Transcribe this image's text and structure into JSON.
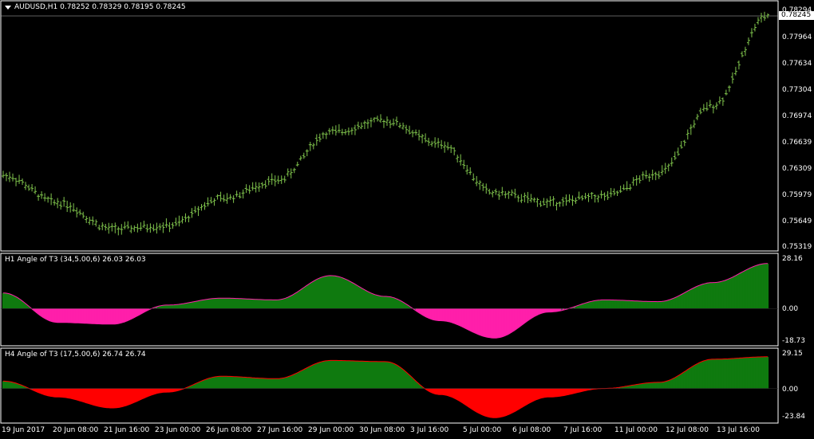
{
  "main_pane": {
    "title": "AUDUSD,H1  0.78252 0.78329 0.78195 0.78245",
    "price_scale": [
      "0.78294",
      "0.77964",
      "0.77634",
      "0.77304",
      "0.76974",
      "0.76639",
      "0.76309",
      "0.75979",
      "0.75649",
      "0.75319"
    ],
    "current_price": "0.78245",
    "icon": "chevron-down-icon"
  },
  "indicator_1": {
    "title": "H1 Angle of T3 (34,5.00,6) 26.03 26.03",
    "scale": [
      "28.16",
      "0.00",
      "-18.73"
    ]
  },
  "indicator_2": {
    "title": "H4 Angle of T3 (17,5.00,6) 26.74 26.74",
    "scale": [
      "29.15",
      "0.00",
      "-23.84"
    ]
  },
  "time_axis": [
    "19 Jun 2017",
    "20 Jun 08:00",
    "21 Jun 16:00",
    "23 Jun 00:00",
    "26 Jun 08:00",
    "27 Jun 16:00",
    "29 Jun 00:00",
    "30 Jun 08:00",
    "3 Jul 16:00",
    "5 Jul 00:00",
    "6 Jul 08:00",
    "7 Jul 16:00",
    "11 Jul 00:00",
    "12 Jul 08:00",
    "13 Jul 16:00"
  ],
  "colors": {
    "background": "#000000",
    "candle": "#7fc34c",
    "grid_border": "#ffffff",
    "bull_fill": "#0f7a0f",
    "h1_bear_fill": "#ff1faa",
    "h4_bear_fill": "#ff0000"
  },
  "chart_data": [
    {
      "type": "line",
      "title": "AUDUSD,H1  0.78252 0.78329 0.78195 0.78245",
      "ylim": [
        0.75319,
        0.78294
      ],
      "x": [
        "19 Jun 2017",
        "20 Jun 08:00",
        "21 Jun 16:00",
        "23 Jun 00:00",
        "26 Jun 08:00",
        "27 Jun 16:00",
        "29 Jun 00:00",
        "30 Jun 08:00",
        "3 Jul 16:00",
        "5 Jul 00:00",
        "6 Jul 08:00",
        "7 Jul 16:00",
        "11 Jul 00:00",
        "12 Jul 08:00",
        "13 Jul 16:00"
      ],
      "series": [
        {
          "values": [
            0.7625,
            0.759,
            0.7556,
            0.756,
            0.7595,
            0.7618,
            0.768,
            0.7695,
            0.7665,
            0.7602,
            0.759,
            0.7598,
            0.7628,
            0.7715,
            0.783
          ]
        }
      ]
    },
    {
      "type": "area",
      "title": "H1 Angle of T3 (34,5.00,6) 26.03 26.03",
      "ylim": [
        -18.73,
        28.16
      ],
      "x": [
        "19 Jun 2017",
        "20 Jun 08:00",
        "21 Jun 16:00",
        "23 Jun 00:00",
        "26 Jun 08:00",
        "27 Jun 16:00",
        "29 Jun 00:00",
        "30 Jun 08:00",
        "3 Jul 16:00",
        "5 Jul 00:00",
        "6 Jul 08:00",
        "7 Jul 16:00",
        "11 Jul 00:00",
        "12 Jul 08:00",
        "13 Jul 16:00"
      ],
      "series": [
        {
          "values": [
            9,
            -8,
            -9,
            2,
            6,
            5,
            19,
            7,
            -7,
            -17,
            -2,
            5,
            4,
            15,
            26
          ]
        }
      ]
    },
    {
      "type": "area",
      "title": "H4 Angle of T3 (17,5.00,6) 26.74 26.74",
      "ylim": [
        -23.84,
        29.15
      ],
      "x": [
        "19 Jun 2017",
        "20 Jun 08:00",
        "21 Jun 16:00",
        "23 Jun 00:00",
        "26 Jun 08:00",
        "27 Jun 16:00",
        "29 Jun 00:00",
        "30 Jun 08:00",
        "3 Jul 16:00",
        "5 Jul 00:00",
        "6 Jul 08:00",
        "7 Jul 16:00",
        "11 Jul 00:00",
        "12 Jul 08:00",
        "13 Jul 16:00"
      ],
      "series": [
        {
          "values": [
            6,
            -7,
            -16,
            -3,
            10,
            8,
            23,
            22,
            -5,
            -24,
            -7,
            0,
            5,
            24,
            26
          ]
        }
      ]
    }
  ]
}
